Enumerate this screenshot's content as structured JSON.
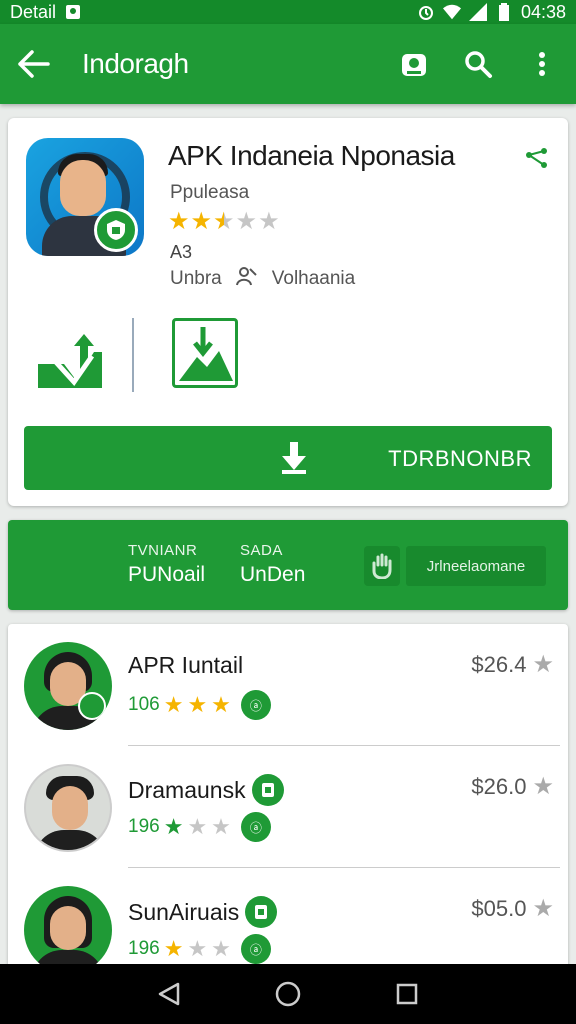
{
  "status_bar": {
    "left_text": "Detail",
    "time": "04:38"
  },
  "app_bar": {
    "title": "Indoragh"
  },
  "app": {
    "title": "APK Indaneia Nponasia",
    "developer": "Ppuleasa",
    "rating_stars": 2.5,
    "rating_count": "A3",
    "meta_left": "Unbra",
    "meta_right": "Volhaania"
  },
  "install_button": {
    "label": "TDRBNONBR"
  },
  "stats": {
    "items": [
      {
        "key": "TVNIANR",
        "value": "PUNoail"
      },
      {
        "key": "SADA",
        "value": "UnDen"
      }
    ],
    "button_label": "Jrlneelaomane"
  },
  "list": [
    {
      "name": "APR Iuntail",
      "count": "106",
      "stars": 3,
      "price": "$26.4"
    },
    {
      "name": "Dramaunsk",
      "count": "196",
      "stars": 1,
      "price": "$26.0"
    },
    {
      "name": "SunAiruais",
      "count": "196",
      "stars": 1,
      "price": "$05.0"
    }
  ],
  "colors": {
    "primary": "#1f9a36",
    "primary_dark": "#148a2a",
    "star": "#f5b400",
    "star_empty": "#c6c6c6"
  }
}
